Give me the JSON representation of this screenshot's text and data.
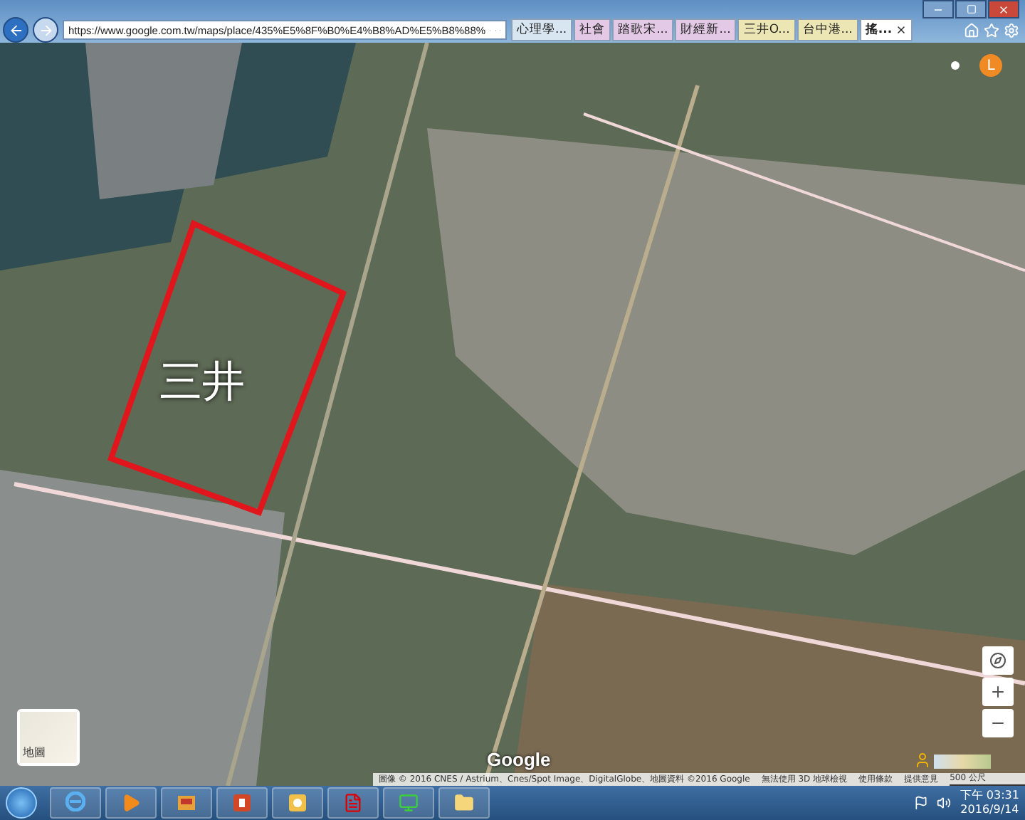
{
  "browser": {
    "address": "https://www.google.com.tw/maps/place/435%E5%8F%B0%E4%B8%AD%E5%B8%88%",
    "tabs": [
      {
        "label": "心理學...",
        "selected": false,
        "color": "#d8e6f2"
      },
      {
        "label": "社會",
        "selected": false,
        "color": "#e3c9e6"
      },
      {
        "label": "踏歌宋...",
        "selected": false,
        "color": "#e3c9e6"
      },
      {
        "label": "財經新...",
        "selected": false,
        "color": "#e3c9e6"
      },
      {
        "label": "三井O...",
        "selected": false,
        "color": "#ece6b4"
      },
      {
        "label": "台中港...",
        "selected": false,
        "color": "#ece6b4"
      },
      {
        "label": "搖...",
        "selected": true,
        "color": "#ffffff"
      }
    ]
  },
  "map": {
    "annotation": "三井",
    "logo": "Google",
    "layer_button": "地圖",
    "account_initial": "L",
    "attribution": [
      "圖像 © 2016 CNES / Astrium、Cnes/Spot Image、DigitalGlobe、地圖資料 ©2016 Google",
      "無法使用 3D 地球檢視",
      "使用條款",
      "提供意見"
    ],
    "scale": "500 公尺"
  },
  "taskbar": {
    "apps": [
      {
        "kind": "ie"
      },
      {
        "kind": "media"
      },
      {
        "kind": "slides"
      },
      {
        "kind": "powerpoint"
      },
      {
        "kind": "notes"
      },
      {
        "kind": "pdf"
      },
      {
        "kind": "monitor"
      },
      {
        "kind": "folder"
      }
    ],
    "time": "下午 03:31",
    "date": "2016/9/14"
  }
}
